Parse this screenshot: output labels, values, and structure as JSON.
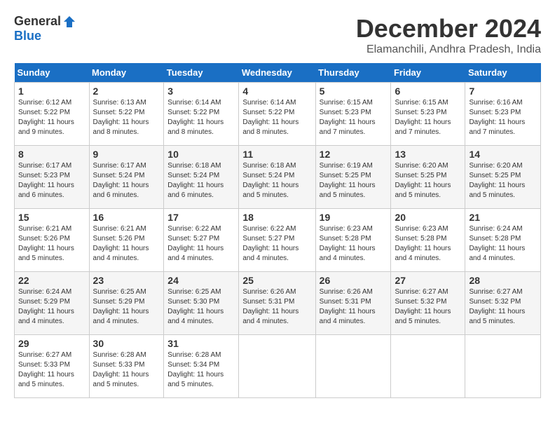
{
  "header": {
    "logo_general": "General",
    "logo_blue": "Blue",
    "month": "December 2024",
    "location": "Elamanchili, Andhra Pradesh, India"
  },
  "columns": [
    "Sunday",
    "Monday",
    "Tuesday",
    "Wednesday",
    "Thursday",
    "Friday",
    "Saturday"
  ],
  "weeks": [
    [
      {
        "day": "1",
        "sunrise": "6:12 AM",
        "sunset": "5:22 PM",
        "daylight": "11 hours and 9 minutes."
      },
      {
        "day": "2",
        "sunrise": "6:13 AM",
        "sunset": "5:22 PM",
        "daylight": "11 hours and 8 minutes."
      },
      {
        "day": "3",
        "sunrise": "6:14 AM",
        "sunset": "5:22 PM",
        "daylight": "11 hours and 8 minutes."
      },
      {
        "day": "4",
        "sunrise": "6:14 AM",
        "sunset": "5:22 PM",
        "daylight": "11 hours and 8 minutes."
      },
      {
        "day": "5",
        "sunrise": "6:15 AM",
        "sunset": "5:23 PM",
        "daylight": "11 hours and 7 minutes."
      },
      {
        "day": "6",
        "sunrise": "6:15 AM",
        "sunset": "5:23 PM",
        "daylight": "11 hours and 7 minutes."
      },
      {
        "day": "7",
        "sunrise": "6:16 AM",
        "sunset": "5:23 PM",
        "daylight": "11 hours and 7 minutes."
      }
    ],
    [
      {
        "day": "8",
        "sunrise": "6:17 AM",
        "sunset": "5:23 PM",
        "daylight": "11 hours and 6 minutes."
      },
      {
        "day": "9",
        "sunrise": "6:17 AM",
        "sunset": "5:24 PM",
        "daylight": "11 hours and 6 minutes."
      },
      {
        "day": "10",
        "sunrise": "6:18 AM",
        "sunset": "5:24 PM",
        "daylight": "11 hours and 6 minutes."
      },
      {
        "day": "11",
        "sunrise": "6:18 AM",
        "sunset": "5:24 PM",
        "daylight": "11 hours and 5 minutes."
      },
      {
        "day": "12",
        "sunrise": "6:19 AM",
        "sunset": "5:25 PM",
        "daylight": "11 hours and 5 minutes."
      },
      {
        "day": "13",
        "sunrise": "6:20 AM",
        "sunset": "5:25 PM",
        "daylight": "11 hours and 5 minutes."
      },
      {
        "day": "14",
        "sunrise": "6:20 AM",
        "sunset": "5:25 PM",
        "daylight": "11 hours and 5 minutes."
      }
    ],
    [
      {
        "day": "15",
        "sunrise": "6:21 AM",
        "sunset": "5:26 PM",
        "daylight": "11 hours and 5 minutes."
      },
      {
        "day": "16",
        "sunrise": "6:21 AM",
        "sunset": "5:26 PM",
        "daylight": "11 hours and 4 minutes."
      },
      {
        "day": "17",
        "sunrise": "6:22 AM",
        "sunset": "5:27 PM",
        "daylight": "11 hours and 4 minutes."
      },
      {
        "day": "18",
        "sunrise": "6:22 AM",
        "sunset": "5:27 PM",
        "daylight": "11 hours and 4 minutes."
      },
      {
        "day": "19",
        "sunrise": "6:23 AM",
        "sunset": "5:28 PM",
        "daylight": "11 hours and 4 minutes."
      },
      {
        "day": "20",
        "sunrise": "6:23 AM",
        "sunset": "5:28 PM",
        "daylight": "11 hours and 4 minutes."
      },
      {
        "day": "21",
        "sunrise": "6:24 AM",
        "sunset": "5:28 PM",
        "daylight": "11 hours and 4 minutes."
      }
    ],
    [
      {
        "day": "22",
        "sunrise": "6:24 AM",
        "sunset": "5:29 PM",
        "daylight": "11 hours and 4 minutes."
      },
      {
        "day": "23",
        "sunrise": "6:25 AM",
        "sunset": "5:29 PM",
        "daylight": "11 hours and 4 minutes."
      },
      {
        "day": "24",
        "sunrise": "6:25 AM",
        "sunset": "5:30 PM",
        "daylight": "11 hours and 4 minutes."
      },
      {
        "day": "25",
        "sunrise": "6:26 AM",
        "sunset": "5:31 PM",
        "daylight": "11 hours and 4 minutes."
      },
      {
        "day": "26",
        "sunrise": "6:26 AM",
        "sunset": "5:31 PM",
        "daylight": "11 hours and 4 minutes."
      },
      {
        "day": "27",
        "sunrise": "6:27 AM",
        "sunset": "5:32 PM",
        "daylight": "11 hours and 5 minutes."
      },
      {
        "day": "28",
        "sunrise": "6:27 AM",
        "sunset": "5:32 PM",
        "daylight": "11 hours and 5 minutes."
      }
    ],
    [
      {
        "day": "29",
        "sunrise": "6:27 AM",
        "sunset": "5:33 PM",
        "daylight": "11 hours and 5 minutes."
      },
      {
        "day": "30",
        "sunrise": "6:28 AM",
        "sunset": "5:33 PM",
        "daylight": "11 hours and 5 minutes."
      },
      {
        "day": "31",
        "sunrise": "6:28 AM",
        "sunset": "5:34 PM",
        "daylight": "11 hours and 5 minutes."
      },
      null,
      null,
      null,
      null
    ]
  ]
}
